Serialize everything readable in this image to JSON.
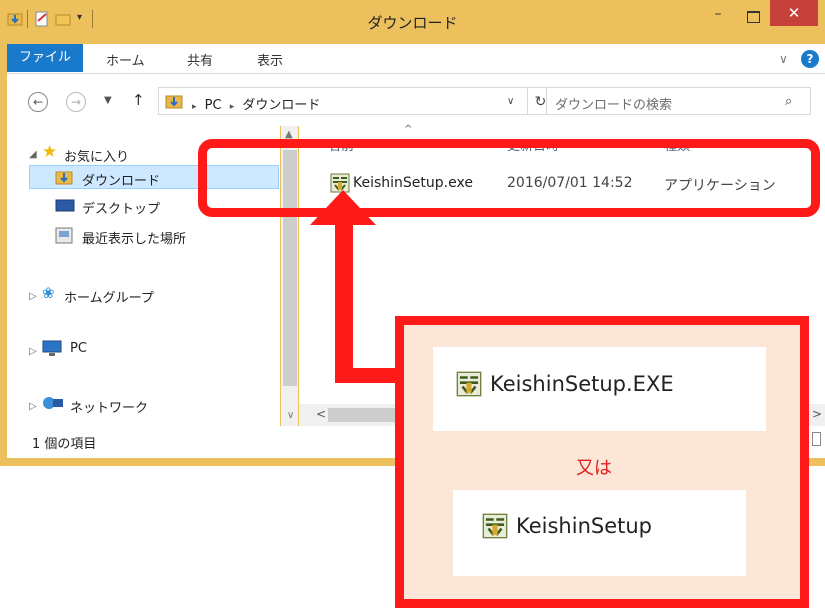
{
  "window": {
    "title": "ダウンロード",
    "minimize": "–",
    "close": "✕"
  },
  "ribbon": {
    "file_tab": "ファイル",
    "tabs": [
      "ホーム",
      "共有",
      "表示"
    ]
  },
  "address": {
    "path_sep": "▸",
    "path": [
      "PC",
      "ダウンロード"
    ],
    "search_placeholder": "ダウンロードの検索"
  },
  "nav": {
    "favorites": "お気に入り",
    "downloads": "ダウンロード",
    "desktop": "デスクトップ",
    "recent": "最近表示した場所",
    "homegroup": "ホームグループ",
    "pc": "PC",
    "network": "ネットワーク"
  },
  "columns": [
    "名前",
    "更新日時",
    "種類"
  ],
  "files": [
    {
      "name": "KeishinSetup.exe",
      "modified": "2016/07/01 14:52",
      "type": "アプリケーション"
    }
  ],
  "status": "1 個の項目",
  "annotation": {
    "option1": "KeishinSetup.EXE",
    "or": "又は",
    "option2": "KeishinSetup"
  },
  "colors": {
    "frame": "#ecc05c",
    "accent": "#1979ca",
    "highlight": "#ff1a1a",
    "callout_bg": "#fbe6d8"
  }
}
